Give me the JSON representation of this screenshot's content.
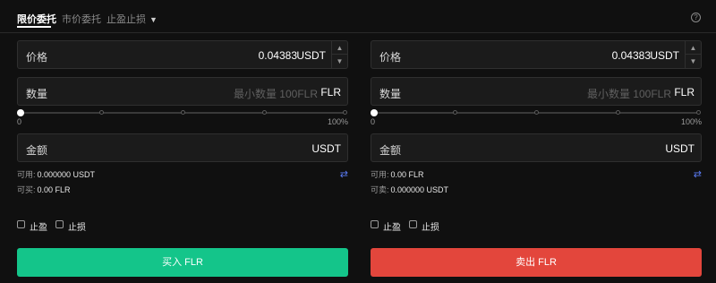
{
  "tabs": {
    "items": [
      {
        "label": "限价委托",
        "active": true
      },
      {
        "label": "市价委托",
        "active": false
      },
      {
        "label": "止盈止损",
        "active": false
      }
    ],
    "help_icon": "question-circle-icon",
    "dropdown_icon": "chevron-down-icon"
  },
  "buy": {
    "price_label": "价格",
    "price_value": "0.04383",
    "price_unit": "USDT",
    "amount_label": "数量",
    "amount_placeholder": "最小数量 100FLR",
    "amount_unit": "FLR",
    "slider_min": "0",
    "slider_max": "100%",
    "slider_fraction": 0,
    "total_label": "金额",
    "total_unit": "USDT",
    "available_label": "可用:",
    "available_value": "0.000000 USDT",
    "can_label": "可买:",
    "can_value": "0.00 FLR",
    "take_profit": "止盈",
    "stop_loss": "止损",
    "action_label": "买入 FLR",
    "action_color": "#14c58a"
  },
  "sell": {
    "price_label": "价格",
    "price_value": "0.04383",
    "price_unit": "USDT",
    "amount_label": "数量",
    "amount_placeholder": "最小数量 100FLR",
    "amount_unit": "FLR",
    "slider_min": "0",
    "slider_max": "100%",
    "slider_fraction": 0,
    "total_label": "金额",
    "total_unit": "USDT",
    "available_label": "可用:",
    "available_value": "0.00 FLR",
    "can_label": "可卖:",
    "can_value": "0.000000 USDT",
    "take_profit": "止盈",
    "stop_loss": "止损",
    "action_label": "卖出 FLR",
    "action_color": "#e3463c"
  },
  "icons": {
    "stepper_up": "caret-up-icon",
    "stepper_down": "caret-down-icon",
    "transfer": "transfer-arrows-icon",
    "checkbox": "checkbox-icon"
  }
}
